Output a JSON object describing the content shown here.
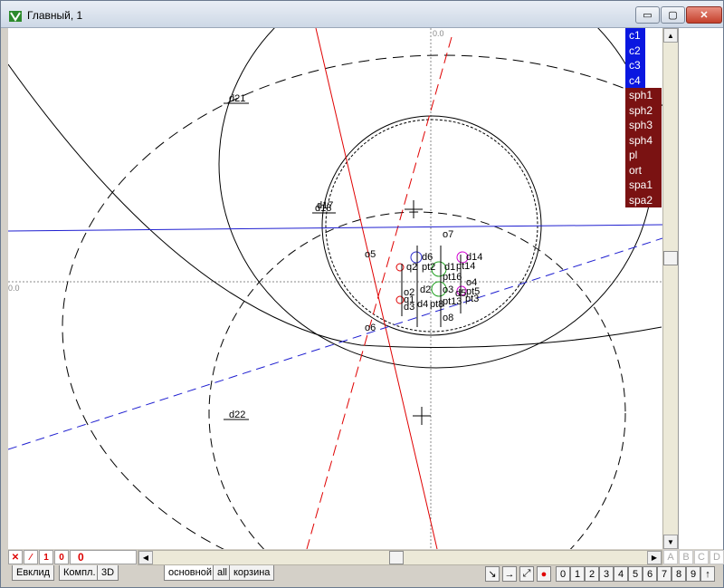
{
  "window": {
    "title": "Главный, 1",
    "min_label": "▭",
    "max_label": "▢",
    "close_label": "✕"
  },
  "layers": [
    {
      "label": "c1",
      "kind": "c"
    },
    {
      "label": "c2",
      "kind": "c"
    },
    {
      "label": "c3",
      "kind": "c"
    },
    {
      "label": "c4",
      "kind": "c"
    },
    {
      "label": "sph1",
      "kind": "s"
    },
    {
      "label": "sph2",
      "kind": "s"
    },
    {
      "label": "sph3",
      "kind": "s"
    },
    {
      "label": "sph4",
      "kind": "s"
    },
    {
      "label": "pl",
      "kind": "s"
    },
    {
      "label": "ort",
      "kind": "s"
    },
    {
      "label": "spa1",
      "kind": "s"
    },
    {
      "label": "spa2",
      "kind": "s"
    }
  ],
  "canvas": {
    "axis_x_label": "0.0",
    "axis_y_label": "0.0",
    "labels": [
      "d21",
      "d22",
      "d18",
      "d17",
      "o5",
      "o6",
      "o7",
      "o8",
      "d6",
      "d14",
      "o2",
      "q2",
      "pt2",
      "d1",
      "pt14",
      "pt16",
      "d2",
      "o4",
      "pt3",
      "q1",
      "o3",
      "pt13",
      "d3",
      "d4",
      "pt8",
      "d5",
      "pt5"
    ]
  },
  "status": {
    "items": [
      "✕",
      "⁄",
      "1",
      "0",
      "0"
    ]
  },
  "scroll_letters": [
    "A",
    "B",
    "C",
    "D"
  ],
  "tabs": [
    {
      "label": "Евклид",
      "active": false
    },
    {
      "label": "Компл.",
      "active": false
    },
    {
      "label": "3D",
      "active": false
    },
    {
      "label": "основной",
      "active": true
    },
    {
      "label": "all",
      "active": false
    },
    {
      "label": "корзина",
      "active": false
    }
  ],
  "toolbar": {
    "tools": [
      "↘",
      "→",
      "⤢",
      "●"
    ],
    "digits": [
      "0",
      "1",
      "2",
      "3",
      "4",
      "5",
      "6",
      "7",
      "8",
      "9",
      "↑"
    ]
  },
  "colors": {
    "layer_c": "#0a17e0",
    "layer_s": "#7a1212",
    "red_line": "#e00000",
    "blue_line": "#1f1fd0"
  }
}
